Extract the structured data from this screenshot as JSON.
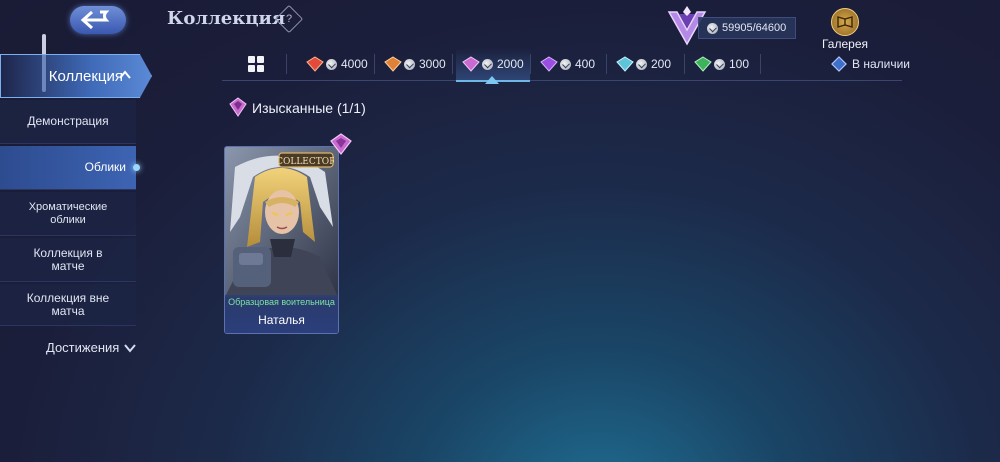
{
  "header": {
    "title": "Коллекция",
    "help": "?"
  },
  "points": {
    "value": "59905/64600"
  },
  "gallery": {
    "label": "Галерея"
  },
  "tabs": [
    {
      "label": "4000",
      "gem_color": "#e24a3b"
    },
    {
      "label": "3000",
      "gem_color": "#e0813a"
    },
    {
      "label": "2000",
      "gem_color": "#c86ad0",
      "active": true
    },
    {
      "label": "400",
      "gem_color": "#9b4fe0"
    },
    {
      "label": "200",
      "gem_color": "#5fc4d9"
    },
    {
      "label": "100",
      "gem_color": "#3fb35c"
    }
  ],
  "filter": {
    "label": "В наличии"
  },
  "sidebar": {
    "collection": "Коллекция",
    "items": [
      {
        "label": "Демонстрация"
      },
      {
        "label": "Облики"
      },
      {
        "label": "Хроматические облики"
      },
      {
        "label": "Коллекция в матче"
      },
      {
        "label": "Коллекция вне матча"
      }
    ],
    "achievements": "Достижения"
  },
  "section": {
    "title": "Изысканные (1/1)"
  },
  "card": {
    "badge": "COLLECTOR",
    "subtitle": "Образцовая воительница",
    "name": "Наталья"
  }
}
